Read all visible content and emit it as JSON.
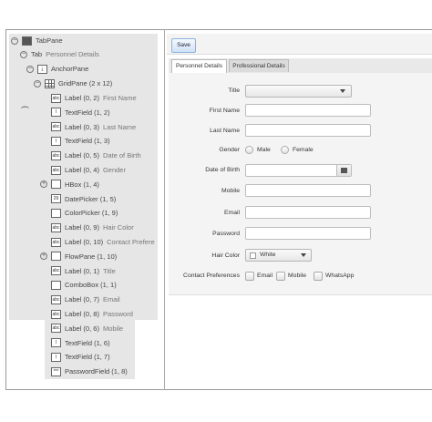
{
  "tree": {
    "root": "TabPane",
    "tab_node": "Tab",
    "tab_node_title": "Personnel Details",
    "anchor": "AnchorPane",
    "grid": "GridPane (2 x 12)",
    "items": [
      {
        "icon_text": "abc",
        "label": "Label (0, 2)",
        "detail": "First Name"
      },
      {
        "icon_text": "I",
        "label": "TextField (1, 2)",
        "detail": ""
      },
      {
        "icon_text": "abc",
        "label": "Label (0, 3)",
        "detail": "Last Name"
      },
      {
        "icon_text": "I",
        "label": "TextField (1, 3)",
        "detail": ""
      },
      {
        "icon_text": "abc",
        "label": "Label (0, 5)",
        "detail": "Date of Birth"
      },
      {
        "icon_text": "abc",
        "label": "Label (0, 4)",
        "detail": "Gender"
      },
      {
        "icon_text": "",
        "label": "HBox (1, 4)",
        "detail": ""
      },
      {
        "icon_text": "29",
        "label": "DatePicker (1, 5)",
        "detail": ""
      },
      {
        "icon_text": "",
        "label": "ColorPicker (1, 9)",
        "detail": ""
      },
      {
        "icon_text": "abc",
        "label": "Label (0, 9)",
        "detail": "Hair Color"
      },
      {
        "icon_text": "abc",
        "label": "Label (0, 10)",
        "detail": "Contact Prefere"
      },
      {
        "icon_text": "",
        "label": "FlowPane (1, 10)",
        "detail": ""
      },
      {
        "icon_text": "abc",
        "label": "Label (0, 1)",
        "detail": "Title"
      },
      {
        "icon_text": "",
        "label": "ComboBox (1, 1)",
        "detail": ""
      },
      {
        "icon_text": "abc",
        "label": "Label (0, 7)",
        "detail": "Email"
      },
      {
        "icon_text": "abc",
        "label": "Label (0, 8)",
        "detail": "Password"
      },
      {
        "icon_text": "abc",
        "label": "Label (0, 6)",
        "detail": "Mobile"
      },
      {
        "icon_text": "I",
        "label": "TextField (1, 6)",
        "detail": ""
      },
      {
        "icon_text": "I",
        "label": "TextField (1, 7)",
        "detail": ""
      },
      {
        "icon_text": "***",
        "label": "PasswordField (1, 8)",
        "detail": ""
      }
    ]
  },
  "toolbar": {
    "save_label": "Save"
  },
  "tabs": [
    {
      "label": "Personnel Details",
      "active": true
    },
    {
      "label": "Professional Details",
      "active": false
    }
  ],
  "form": {
    "title_label": "Title",
    "first_name_label": "First Name",
    "last_name_label": "Last Name",
    "gender_label": "Gender",
    "gender_options": [
      "Male",
      "Female"
    ],
    "dob_label": "Date of Birth",
    "mobile_label": "Mobile",
    "email_label": "Email",
    "password_label": "Password",
    "hair_color_label": "Hair Color",
    "hair_color_value": "White",
    "contact_label": "Contact Preferences",
    "contact_options": [
      "Email",
      "Mobile",
      "WhatsApp"
    ]
  }
}
